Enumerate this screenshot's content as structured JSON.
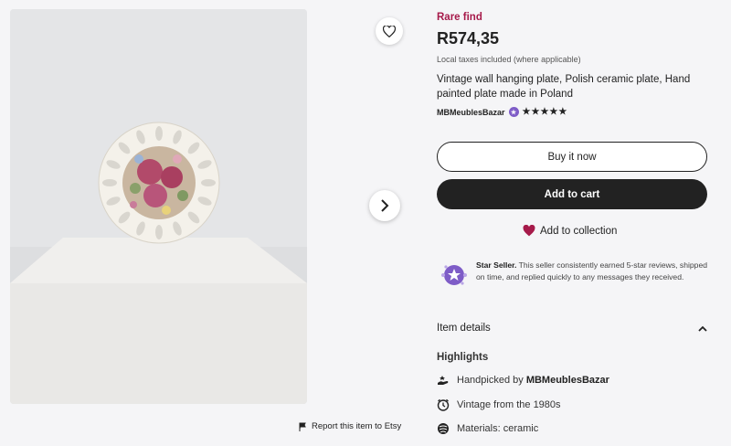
{
  "listing": {
    "rare_label": "Rare find",
    "price": "R574,35",
    "taxes_note": "Local taxes included (where applicable)",
    "title": "Vintage wall hanging plate, Polish ceramic plate, Hand painted plate made in Poland",
    "shop_name": "MBMeublesBazar",
    "rating_stars": "★★★★★",
    "rating_value": 5
  },
  "actions": {
    "buy_now": "Buy it now",
    "add_to_cart": "Add to cart",
    "add_to_collection": "Add to collection",
    "report": "Report this item to Etsy"
  },
  "star_seller": {
    "label": "Star Seller.",
    "text": " This seller consistently earned 5-star reviews, shipped on time, and replied quickly to any messages they received."
  },
  "details": {
    "heading": "Item details",
    "highlights_heading": "Highlights",
    "handpicked_prefix": "Handpicked by ",
    "handpicked_shop": "MBMeublesBazar",
    "vintage": "Vintage from the 1980s",
    "materials": "Materials: ceramic"
  },
  "colors": {
    "accent_rare": "#a61a4a",
    "star_seller_purple": "#7e5cc7",
    "button_dark": "#222222",
    "heart": "#a61a4a"
  },
  "icons": [
    "heart-outline-icon",
    "chevron-right-icon",
    "flag-icon",
    "heart-filled-icon",
    "star-seller-badge-icon",
    "chevron-up-icon",
    "handpicked-icon",
    "clock-icon",
    "materials-icon"
  ]
}
